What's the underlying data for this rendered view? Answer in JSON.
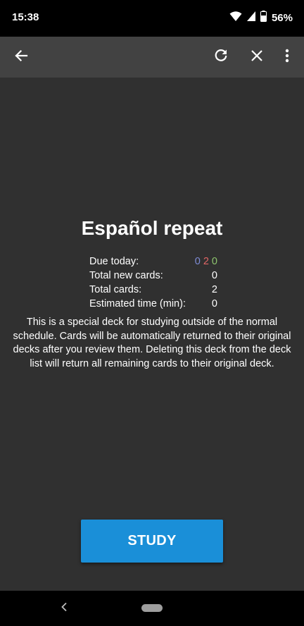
{
  "status_bar": {
    "time": "15:38",
    "battery_percent": "56%",
    "icons": [
      "wifi-icon",
      "cell-signal-icon",
      "battery-icon"
    ]
  },
  "toolbar": {
    "icons": [
      "back-arrow-icon",
      "refresh-icon",
      "close-icon",
      "more-vert-icon"
    ]
  },
  "deck": {
    "title": "Español repeat",
    "stats": {
      "due_label": "Due today:",
      "due_new": "0",
      "due_learning": "2",
      "due_review": "0",
      "new_label": "Total new cards:",
      "new_value": "0",
      "total_label": "Total cards:",
      "total_value": "2",
      "time_label": "Estimated time (min):",
      "time_value": "0"
    },
    "description": "This is a special deck for studying outside of the normal schedule. Cards will be automatically returned to their original decks after you review them. Deleting this deck from the deck list will return all remaining cards to their original deck."
  },
  "actions": {
    "study_label": "STUDY"
  },
  "colors": {
    "background": "#303030",
    "toolbar": "#424242",
    "study_button": "#1a8fd8",
    "due_new": "#7f8cd6",
    "due_learning": "#e06666",
    "due_review": "#8ec56e"
  },
  "nav_bar": {
    "icons": [
      "nav-back-icon",
      "nav-home-pill"
    ]
  }
}
